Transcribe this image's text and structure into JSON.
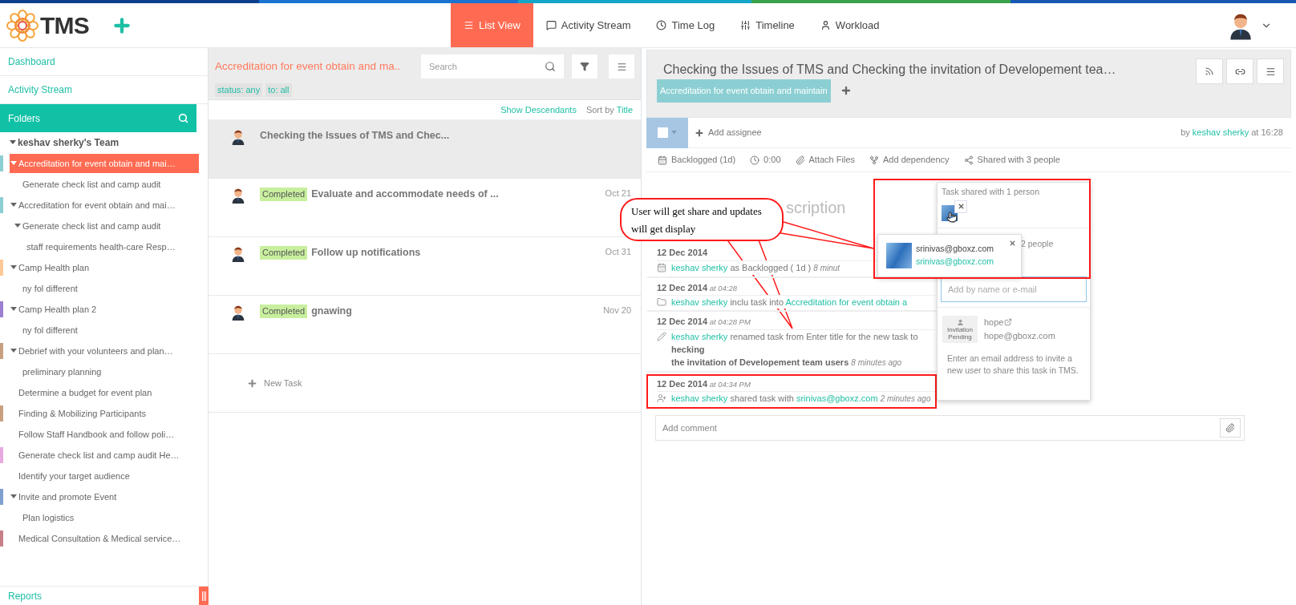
{
  "header": {
    "logo": "TMS",
    "nav": [
      {
        "label": "List View",
        "kind": "list",
        "selected": true
      },
      {
        "label": "Activity Stream",
        "kind": "comment",
        "selected": false
      },
      {
        "label": "Time Log",
        "kind": "clock",
        "selected": false
      },
      {
        "label": "Timeline",
        "kind": "sliders",
        "selected": false
      },
      {
        "label": "Workload",
        "kind": "user",
        "selected": false
      }
    ]
  },
  "sidebar": {
    "links": [
      "Dashboard",
      "Activity Stream"
    ],
    "folders_title": "Folders",
    "tree": [
      {
        "label": "keshav sherky's Team",
        "expanded": true,
        "selected": false,
        "children": [
          {
            "label": "Accreditation for event obtain and mai…",
            "color": "#8ccfd3",
            "expanded": true,
            "selected": true,
            "children": [
              {
                "label": "Generate check list and camp audit",
                "selected": false
              }
            ]
          },
          {
            "label": "Accreditation for event obtain and mai…",
            "color": "#8ccfd3",
            "expanded": true,
            "selected": false,
            "children": [
              {
                "label": "Generate check list and camp audit",
                "expanded": true,
                "selected": false,
                "children": [
                  {
                    "label": "staff requirements health-care Resp…",
                    "selected": false
                  }
                ]
              }
            ]
          },
          {
            "label": "Camp Health plan",
            "color": "#ffc896",
            "expanded": true,
            "selected": false,
            "children": [
              {
                "label": "ny fol different",
                "selected": false
              }
            ]
          },
          {
            "label": "Camp Health plan 2",
            "color": "#9b7fd0",
            "expanded": true,
            "selected": false,
            "children": [
              {
                "label": "ny fol different",
                "selected": false
              }
            ]
          },
          {
            "label": "Debrief with your volunteers and plan…",
            "color": "#c8a080",
            "expanded": true,
            "selected": false,
            "children": [
              {
                "label": "preliminary planning",
                "selected": false
              }
            ]
          },
          {
            "label": "Determine a budget for event plan",
            "selected": false
          },
          {
            "label": "Finding & Mobilizing Participants",
            "color": "#c8a080",
            "selected": false
          },
          {
            "label": "Follow Staff Handbook and follow poli…",
            "selected": false
          },
          {
            "label": "Generate check list and camp audit He…",
            "color": "#e8a8e0",
            "selected": false
          },
          {
            "label": "Identify your target audience",
            "selected": false
          },
          {
            "label": "Invite and promote Event",
            "color": "#7f9fd0",
            "expanded": true,
            "selected": false,
            "children": [
              {
                "label": "Plan logistics",
                "selected": false
              }
            ]
          },
          {
            "label": "Medical Consultation & Medical service…",
            "color": "#c88088",
            "selected": false
          }
        ]
      }
    ],
    "footer": "Reports"
  },
  "list": {
    "title": "Accreditation for event obtain and ma..",
    "search_placeholder": "Search",
    "filters": [
      "status: any",
      "to: all"
    ],
    "show_descendants": "Show Descendants",
    "sort_label": "Sort by",
    "sort_value": "Title",
    "tasks": [
      {
        "title": "Checking the Issues of TMS and Chec...",
        "selected": true
      },
      {
        "status": "Completed",
        "title": "Evaluate and accommodate needs of ...",
        "date": "Oct 21",
        "selected": false
      },
      {
        "status": "Completed",
        "title": "Follow up notifications",
        "date": "Oct 31",
        "selected": false
      },
      {
        "status": "Completed",
        "title": "gnawing",
        "date": "Nov 20",
        "selected": false
      }
    ],
    "new_task": "New Task"
  },
  "detail": {
    "title": "Checking the Issues of TMS and Checking the invitation of Developement tea…",
    "tag": "Accreditation for event obtain and maintain",
    "assign_checked": false,
    "add_assignee": "Add assignee",
    "author": {
      "prefix": "by",
      "name": "keshav sherky",
      "suffix": "at 16:28"
    },
    "toolbar": [
      {
        "kind": "calendar",
        "label": "Backlogged (1d)"
      },
      {
        "kind": "clock",
        "label": "0:00"
      },
      {
        "kind": "paperclip",
        "label": "Attach Files"
      },
      {
        "kind": "dependency",
        "label": "Add dependency"
      },
      {
        "kind": "share",
        "label": "Shared with 3 people"
      }
    ],
    "description_heading": "scription",
    "activities": [
      {
        "date": "12 Dec 2014",
        "kind": "calendar",
        "highlighted": false,
        "lines": [
          [
            {
              "kind": "link",
              "text": "keshav sherky"
            },
            {
              "kind": "plain",
              "text": "as Backlogged ( 1d )"
            },
            {
              "kind": "ago",
              "text": "8 minut"
            }
          ]
        ]
      },
      {
        "date": "12 Dec 2014",
        "time": "at 04:28",
        "kind": "folder",
        "highlighted": false,
        "lines": [
          [
            {
              "kind": "link",
              "text": "keshav sherky"
            },
            {
              "kind": "plain",
              "text": "inclu"
            },
            {
              "kind": "plain",
              "text": "task into"
            },
            {
              "kind": "link",
              "text": "Accreditation for event obtain a"
            }
          ]
        ]
      },
      {
        "date": "12 Dec 2014",
        "time": "at 04:28 PM",
        "kind": "pencil",
        "highlighted": false,
        "lines": [
          [
            {
              "kind": "link",
              "text": "keshav sherky"
            },
            {
              "kind": "plain",
              "text": "renamed task from Enter title for the new task to"
            },
            {
              "kind": "bold",
              "text": "hecking"
            }
          ],
          [
            {
              "kind": "bold",
              "text": "the invitation of Developement team users"
            },
            {
              "kind": "ago",
              "text": "8 minutes ago"
            }
          ]
        ]
      },
      {
        "date": "12 Dec 2014",
        "time": "at 04:34 PM",
        "kind": "share",
        "highlighted": true,
        "lines": [
          [
            {
              "kind": "link",
              "text": "keshav sherky"
            },
            {
              "kind": "plain",
              "text": "shared task with"
            },
            {
              "kind": "link",
              "text": "srinivas@gboxz.com"
            },
            {
              "kind": "ago",
              "text": "2 minutes ago"
            }
          ]
        ]
      }
    ],
    "comment_placeholder": "Add comment"
  },
  "share_popup": {
    "heading": "Task shared with 1 person",
    "second_heading": "2 people",
    "input_placeholder": "Add by name or e-mail",
    "suggestion": {
      "badge": "Invitation Pending",
      "name": "hope",
      "email": "hope@gboxz.com"
    },
    "hint": "Enter an email address to invite a new user to share this task in TMS."
  },
  "person_card": {
    "name": "srinivas@gboxz.com",
    "email": "srinivas@gboxz.com"
  },
  "callout": {
    "text": "User will get share and updates will get display"
  }
}
